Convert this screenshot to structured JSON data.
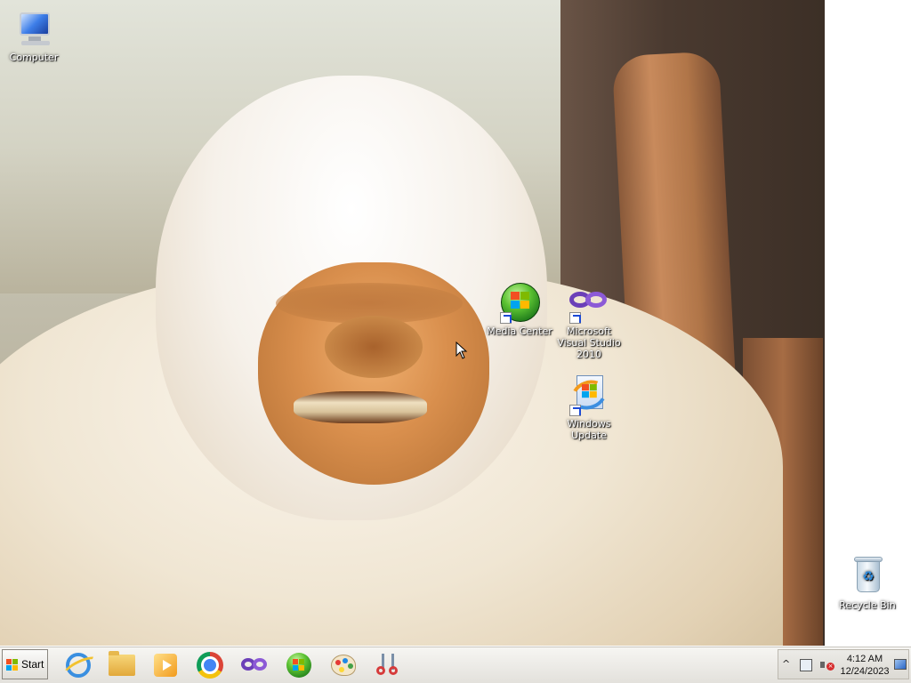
{
  "desktop": {
    "icons": [
      {
        "id": "computer",
        "label": "Computer",
        "icon": "computer-icon"
      },
      {
        "id": "media-center",
        "label": "Media Center",
        "icon": "media-center-icon",
        "shortcut": true
      },
      {
        "id": "visual-studio",
        "label": "Microsoft Visual Studio 2010",
        "icon": "visual-studio-icon",
        "shortcut": true
      },
      {
        "id": "windows-update",
        "label": "Windows Update",
        "icon": "windows-update-icon",
        "shortcut": true
      },
      {
        "id": "recycle-bin",
        "label": "Recycle Bin",
        "icon": "recycle-bin-icon"
      }
    ],
    "wallpaper": "white-gorilla-photo"
  },
  "taskbar": {
    "start_label": "Start",
    "pinned": [
      {
        "id": "ie",
        "icon": "internet-explorer-icon"
      },
      {
        "id": "explorer",
        "icon": "folder-icon"
      },
      {
        "id": "media-player",
        "icon": "media-player-icon"
      },
      {
        "id": "chrome",
        "icon": "chrome-icon"
      },
      {
        "id": "visual-studio",
        "icon": "visual-studio-icon"
      },
      {
        "id": "media-center",
        "icon": "media-center-icon"
      },
      {
        "id": "paint",
        "icon": "paint-icon"
      },
      {
        "id": "snipping-tool",
        "icon": "snipping-tool-icon"
      }
    ]
  },
  "tray": {
    "expand_glyph": "^",
    "time": "4:12 AM",
    "date": "12/24/2023",
    "volume_muted_glyph": "×"
  },
  "colors": {
    "taskbar": "#e3e1dc",
    "accent": "#3a8fe0"
  }
}
